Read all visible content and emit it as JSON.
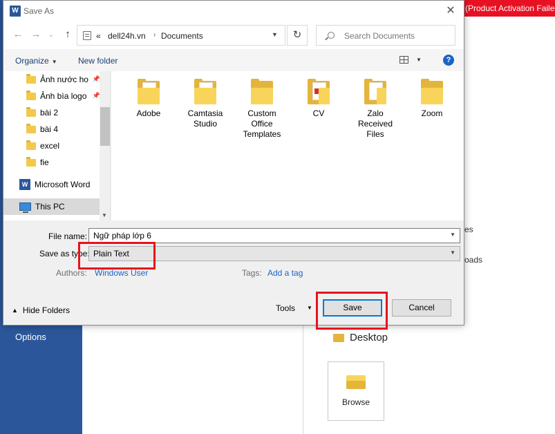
{
  "backstage": {
    "options_label": "Options",
    "activation_banner": "(Product Activation Failed)",
    "peek_es": "es",
    "peek_oads": "oads",
    "desktop_label": "Desktop",
    "browse_label": "Browse"
  },
  "dialog": {
    "title": "Save As",
    "title_icon": "W"
  },
  "address_bar": {
    "overflow": "«",
    "crumbs": [
      "dell24h.vn",
      "Documents"
    ],
    "separator": "›",
    "search_placeholder": "Search Documents"
  },
  "toolbar": {
    "organize_label": "Organize",
    "new_folder_label": "New folder",
    "help_label": "?"
  },
  "nav_pane": {
    "items": [
      {
        "label": "Ảnh nước ho",
        "icon": "folder-icon",
        "pinned": true
      },
      {
        "label": "Ảnh bìa logo",
        "icon": "folder-icon",
        "pinned": true
      },
      {
        "label": "bài 2",
        "icon": "folder-icon"
      },
      {
        "label": "bài 4",
        "icon": "folder-icon"
      },
      {
        "label": "excel",
        "icon": "folder-icon"
      },
      {
        "label": "fie",
        "icon": "folder-icon"
      },
      {
        "label": "Microsoft Word",
        "icon": "word-icon"
      },
      {
        "label": "This PC",
        "icon": "computer-icon",
        "selected": true
      }
    ]
  },
  "files": [
    {
      "name": "Adobe"
    },
    {
      "name": "Camtasia Studio"
    },
    {
      "name": "Custom Office Templates"
    },
    {
      "name": "CV"
    },
    {
      "name": "Zalo Received Files"
    },
    {
      "name": "Zoom"
    }
  ],
  "form": {
    "file_name_label": "File name:",
    "file_name_value": "Ngữ pháp lớp 6",
    "save_type_label": "Save as type:",
    "save_type_value": "Plain Text",
    "authors_label": "Authors:",
    "authors_value": "Windows User",
    "tags_label": "Tags:",
    "tags_value": "Add a tag"
  },
  "footer": {
    "hide_folders_label": "Hide Folders",
    "tools_label": "Tools",
    "save_label": "Save",
    "cancel_label": "Cancel"
  },
  "colors": {
    "word_blue": "#2b579a",
    "activation_red": "#e81123",
    "highlight_red": "#e8121c",
    "link_blue": "#1a64c8"
  }
}
